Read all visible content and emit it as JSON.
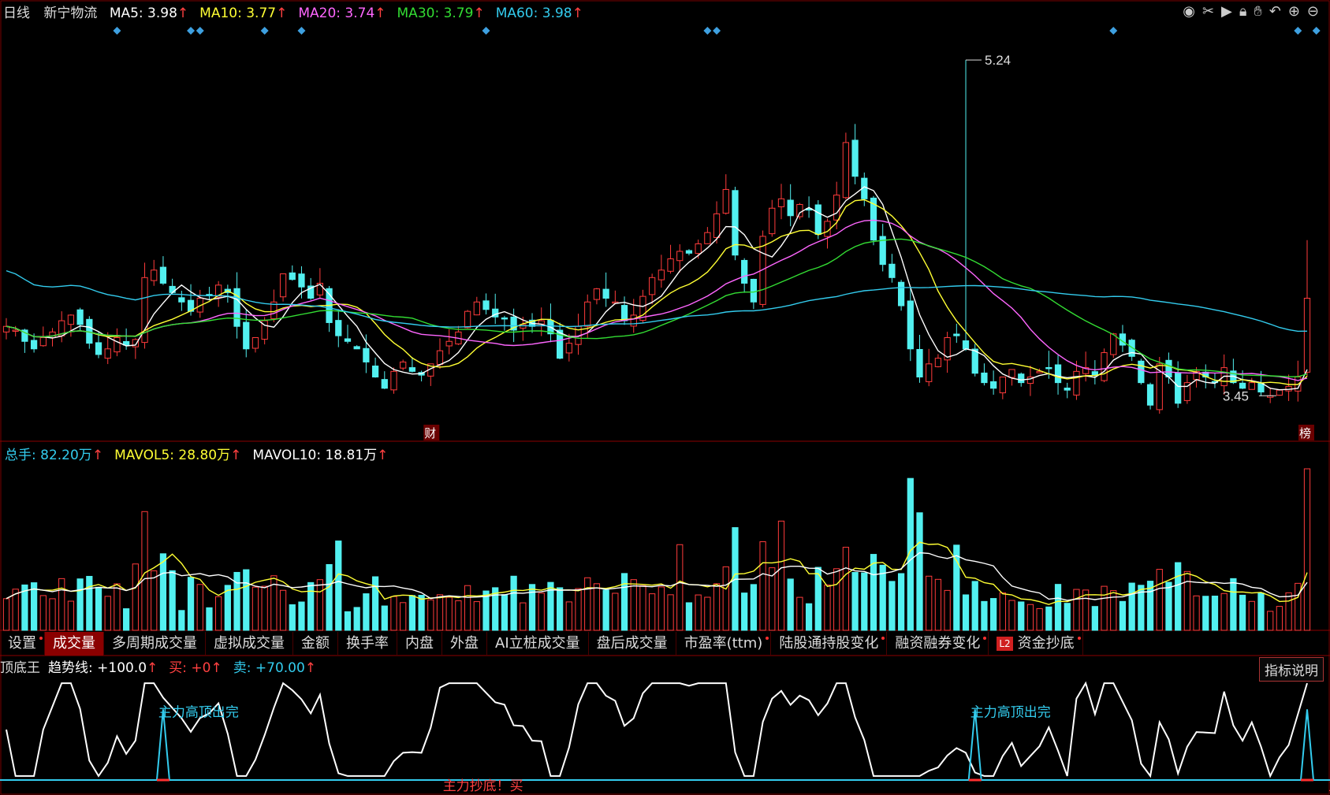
{
  "header": {
    "period": "日线",
    "stock_name": "新宁物流",
    "ma": [
      {
        "label": "MA5:",
        "value": "3.98",
        "color": "#ffffff"
      },
      {
        "label": "MA10:",
        "value": "3.77",
        "color": "#ffff33"
      },
      {
        "label": "MA20:",
        "value": "3.74",
        "color": "#ff66ff"
      },
      {
        "label": "MA30:",
        "value": "3.79",
        "color": "#33dd33"
      },
      {
        "label": "MA60:",
        "value": "3.98",
        "color": "#33ccee"
      }
    ],
    "arrow": "↑"
  },
  "toolbar_icons": [
    "eye-icon",
    "scissors-icon",
    "play-icon",
    "lock-icon",
    "hand-icon",
    "undo-icon",
    "zoom-in-icon",
    "zoom-out-icon"
  ],
  "volume_header": [
    {
      "label": "总手:",
      "value": "82.20万",
      "color": "#33ccee"
    },
    {
      "label": "MAVOL5:",
      "value": "28.80万",
      "color": "#ffff33"
    },
    {
      "label": "MAVOL10:",
      "value": "18.81万",
      "color": "#ffffff"
    }
  ],
  "tabs": [
    {
      "label": "设置",
      "active": false,
      "dot": true
    },
    {
      "label": "成交量",
      "active": true,
      "dot": false
    },
    {
      "label": "多周期成交量",
      "active": false,
      "dot": false
    },
    {
      "label": "虚拟成交量",
      "active": false,
      "dot": false
    },
    {
      "label": "金额",
      "active": false,
      "dot": false
    },
    {
      "label": "换手率",
      "active": false,
      "dot": false
    },
    {
      "label": "内盘",
      "active": false,
      "dot": false
    },
    {
      "label": "外盘",
      "active": false,
      "dot": false
    },
    {
      "label": "AI立桩成交量",
      "active": false,
      "dot": false
    },
    {
      "label": "盘后成交量",
      "active": false,
      "dot": false
    },
    {
      "label": "市盈率(ttm)",
      "active": false,
      "dot": true
    },
    {
      "label": "陆股通持股变化",
      "active": false,
      "dot": true
    },
    {
      "label": "融资融券变化",
      "active": false,
      "dot": true
    },
    {
      "label": "资金抄底",
      "active": false,
      "dot": true,
      "badge": "L2"
    }
  ],
  "indicator_header": {
    "name": "顶底王",
    "items": [
      {
        "label": "趋势线:",
        "value": "+100.0",
        "color": "#ffffff"
      },
      {
        "label": "买:",
        "value": "+0",
        "color": "#ff4040"
      },
      {
        "label": "卖:",
        "value": "+70.00",
        "color": "#33ccee"
      }
    ]
  },
  "explain_button": "指标说明",
  "chart_data": {
    "type": "candlestick",
    "title": "新宁物流 日线",
    "annotations": {
      "high_label": "5.24",
      "low_label": "3.45",
      "marker_cai": "财",
      "marker_bang": "榜",
      "sell_signal": "主力高顶出完",
      "buy_signal": "主力抄底！买"
    },
    "price_range": [
      3.3,
      5.35
    ],
    "closes": [
      3.82,
      3.8,
      3.74,
      3.7,
      3.76,
      3.79,
      3.85,
      3.88,
      3.83,
      3.73,
      3.67,
      3.7,
      3.76,
      3.72,
      3.75,
      4.08,
      4.12,
      4.05,
      4.0,
      3.95,
      3.9,
      3.97,
      3.99,
      4.04,
      4.0,
      3.82,
      3.7,
      3.76,
      3.85,
      3.95,
      4.1,
      4.07,
      4.03,
      3.97,
      4.05,
      3.84,
      3.77,
      3.74,
      3.7,
      3.63,
      3.55,
      3.49,
      3.58,
      3.63,
      3.58,
      3.56,
      3.62,
      3.69,
      3.74,
      3.79,
      3.9,
      3.95,
      3.91,
      3.87,
      3.86,
      3.8,
      3.83,
      3.82,
      3.85,
      3.78,
      3.65,
      3.73,
      3.82,
      3.95,
      4.02,
      3.97,
      3.95,
      3.85,
      3.88,
      3.98,
      4.08,
      4.12,
      4.18,
      4.22,
      4.21,
      4.26,
      4.32,
      4.42,
      4.55,
      4.2,
      4.05,
      3.95,
      4.3,
      4.45,
      4.5,
      4.41,
      4.47,
      4.44,
      4.31,
      4.38,
      4.52,
      4.8,
      4.62,
      4.5,
      4.28,
      4.15,
      4.08,
      3.93,
      3.7,
      3.55,
      3.62,
      3.65,
      3.76,
      3.77,
      3.7,
      3.57,
      3.52,
      3.49,
      3.55,
      3.59,
      3.52,
      3.55,
      3.58,
      3.6,
      3.52,
      3.48,
      3.58,
      3.6,
      3.56,
      3.68,
      3.78,
      3.72,
      3.66,
      3.52,
      3.4,
      3.62,
      3.55,
      3.41,
      3.52,
      3.58,
      3.55,
      3.52,
      3.6,
      3.52,
      3.49,
      3.52,
      3.47,
      3.45,
      3.48,
      3.5,
      3.55,
      3.97
    ],
    "ma_series": [
      "MA5",
      "MA10",
      "MA20",
      "MA30",
      "MA60"
    ],
    "volume_unit": "万",
    "last_volume": 82.2,
    "indicator_range": [
      0,
      100
    ]
  }
}
